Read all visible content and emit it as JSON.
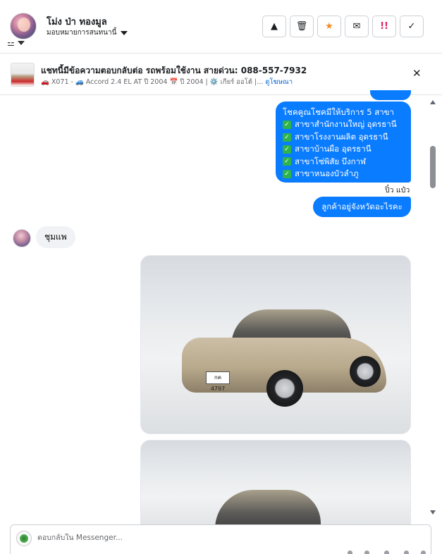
{
  "header": {
    "contact_name": "โม่ง ป่า ทองมูล",
    "assign_label": "มอบหมายการสนทนานี้",
    "actions": [
      {
        "icon": "warning-icon",
        "glyph": "▲",
        "name": "report-button"
      },
      {
        "icon": "trash-icon",
        "glyph": "🗑",
        "name": "delete-button"
      },
      {
        "icon": "star-icon",
        "glyph": "★",
        "name": "star-button"
      },
      {
        "icon": "envelope-icon",
        "glyph": "✉",
        "name": "mark-unread-button"
      },
      {
        "icon": "urgent-icon",
        "glyph": "!!",
        "name": "follow-up-button"
      },
      {
        "icon": "check-icon",
        "glyph": "✓",
        "name": "done-button"
      }
    ],
    "filter_icon": "filter-sliders-icon"
  },
  "ad": {
    "title": "แชทนี้มีข้อความตอบกลับต่อ รถพร้อมใช้งาน สายด่วน: 088-557-7932",
    "meta_code": "🚗 X071 - 🚙 Accord 2.4 EL AT ปี 2004 📅 ปี 2004 | ⚙️ เกียร์ ออโต้ |...",
    "meta_link": "ดูโฆษณา",
    "close_icon": "close-icon"
  },
  "messages": {
    "branches_intro": "โชคคูณโชคมีให้บริการ 5 สาขา",
    "branches": [
      "สาขาสำนักงานใหญ่ อุดรธานี",
      "สาขาโรงงานผลิต อุดรธานี",
      "สาขาบ้านผือ อุดรธานี",
      "สาขาโซ่พิสัย บึงกาฬ",
      "สาขาหนองบัวลำภู"
    ],
    "sender_label": "ปิ๋ว แป๋ว",
    "ask_text": "ลูกค้าอยู่จังหวัดอะไรคะ",
    "customer_reply": "ชุมแพ",
    "car_plate": "กค 4797"
  },
  "composer": {
    "placeholder": "ตอบกลับใน Messenger..."
  },
  "colors": {
    "outgoing_bubble": "#0a7cff",
    "incoming_bubble": "#f0f2f5",
    "check_green": "#2fb44a",
    "star_orange": "#f28b1d"
  }
}
